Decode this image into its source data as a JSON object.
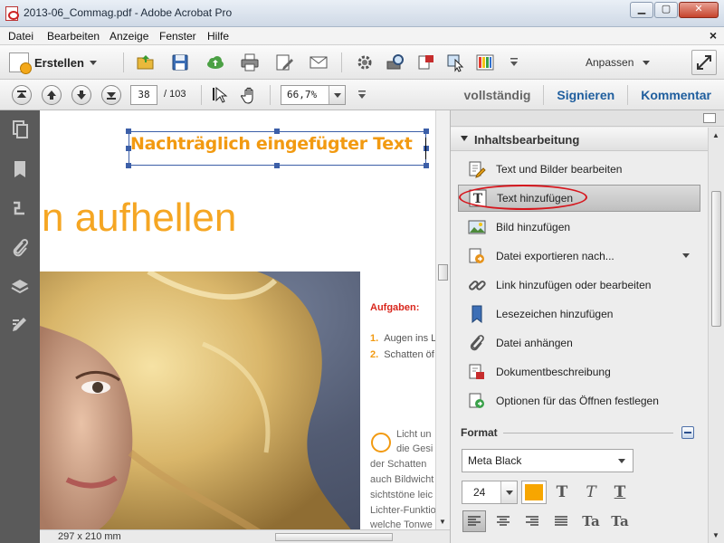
{
  "window": {
    "title": "2013-06_Commag.pdf - Adobe Acrobat Pro",
    "minimize": "▁",
    "maximize": "▢",
    "close": "✕"
  },
  "menu": {
    "items": [
      "Datei",
      "Bearbeiten",
      "Anzeige",
      "Fenster",
      "Hilfe"
    ],
    "close": "×"
  },
  "toolbar": {
    "erstellen_label": "Erstellen",
    "anpassen_label": "Anpassen",
    "icons": [
      "open-folder-icon",
      "save-icon",
      "upload-cloud-icon",
      "print-icon",
      "edit-sign-icon",
      "mail-icon",
      "gear-icon",
      "find-icon",
      "export-icon",
      "select-tool-icon",
      "color-bars-icon"
    ]
  },
  "navbar": {
    "current_page": "38",
    "total_pages": "/ 103",
    "zoom": "66,7%",
    "links": [
      "vollständig",
      "Signieren",
      "Kommentar"
    ]
  },
  "document": {
    "inserted_text": "Nachträglich eingefügter Text",
    "heading_fragment": "n aufhellen",
    "tasks_title": "Aufgaben:",
    "tasks": [
      {
        "num": "1.",
        "text": "Augen ins L"
      },
      {
        "num": "2.",
        "text": "Schatten öf"
      }
    ],
    "body_lines": [
      "Licht un",
      "die Gesi",
      "der Schatten",
      "auch Bildwicht",
      "sichtstöne leic",
      "Lichter-Funktio",
      "welche Tonwe"
    ],
    "dimensions": "297 x 210 mm"
  },
  "panel": {
    "section_title": "Inhaltsbearbeitung",
    "items": [
      {
        "label": "Text und Bilder bearbeiten",
        "icon": "edit-text-images-icon"
      },
      {
        "label": "Text hinzufügen",
        "icon": "add-text-icon"
      },
      {
        "label": "Bild hinzufügen",
        "icon": "add-image-icon"
      },
      {
        "label": "Datei exportieren nach...",
        "icon": "export-file-icon"
      },
      {
        "label": "Link hinzufügen oder bearbeiten",
        "icon": "link-icon"
      },
      {
        "label": "Lesezeichen hinzufügen",
        "icon": "bookmark-icon"
      },
      {
        "label": "Datei anhängen",
        "icon": "paperclip-icon"
      },
      {
        "label": "Dokumentbeschreibung",
        "icon": "document-properties-icon"
      },
      {
        "label": "Optionen für das Öffnen festlegen",
        "icon": "open-options-icon"
      }
    ],
    "format_label": "Format",
    "font": "Meta Black",
    "font_size": "24",
    "font_color": "#f7a600",
    "style_buttons": [
      "T",
      "T",
      "T"
    ],
    "script_buttons": [
      "Ta",
      "Ta"
    ]
  },
  "colors": {
    "accent_orange": "#f29a11",
    "highlight_red": "#d6161d",
    "link_blue": "#1f5e9e"
  }
}
